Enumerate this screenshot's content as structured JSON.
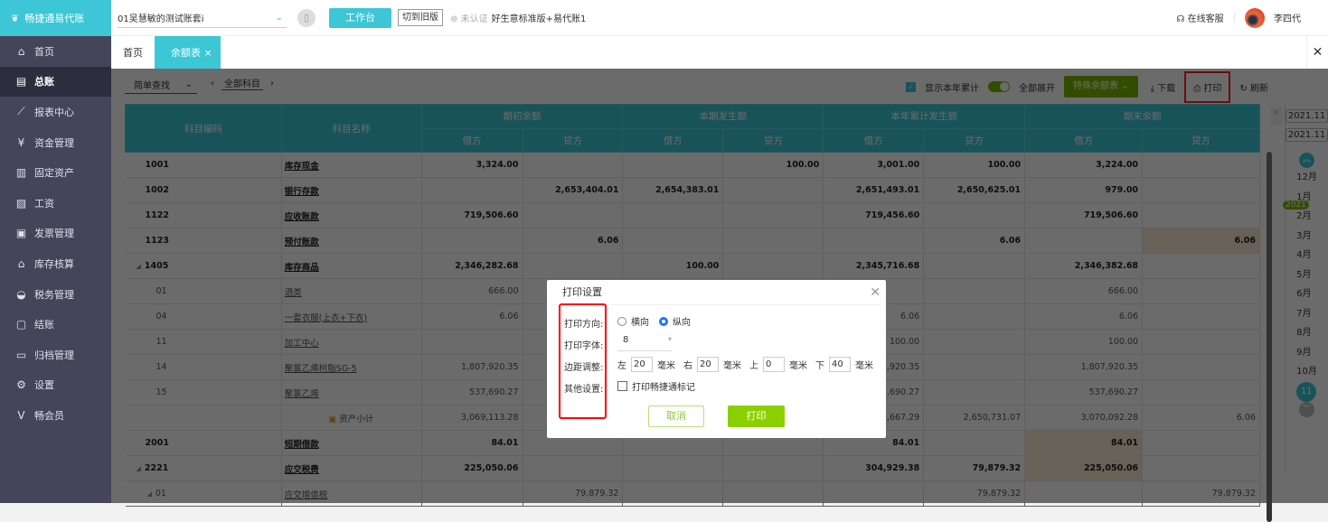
{
  "app": {
    "name": "畅捷通易代账",
    "account": "01吴慧敏的测试账套i",
    "workbench": "工作台",
    "switch_old": "切到旧版",
    "cert": "未认证",
    "version": "好生意标准版+易代账1",
    "service": "在线客服",
    "user": "李四代"
  },
  "sidebar": [
    {
      "icon": "home-icon",
      "glyph": "⌂",
      "label": "首页"
    },
    {
      "icon": "ledger-icon",
      "glyph": "▤",
      "label": "总账",
      "active": true
    },
    {
      "icon": "chart-icon",
      "glyph": "⟋",
      "label": "报表中心"
    },
    {
      "icon": "money-bag-icon",
      "glyph": "¥",
      "label": "资金管理"
    },
    {
      "icon": "building-icon",
      "glyph": "▥",
      "label": "固定资产"
    },
    {
      "icon": "salary-icon",
      "glyph": "▨",
      "label": "工资"
    },
    {
      "icon": "invoice-icon",
      "glyph": "▣",
      "label": "发票管理"
    },
    {
      "icon": "warehouse-icon",
      "glyph": "⌂",
      "label": "库存核算"
    },
    {
      "icon": "tax-icon",
      "glyph": "◒",
      "label": "税务管理"
    },
    {
      "icon": "close-account-icon",
      "glyph": "▢",
      "label": "结账"
    },
    {
      "icon": "archive-icon",
      "glyph": "▭",
      "label": "归档管理"
    },
    {
      "icon": "gear-icon",
      "glyph": "⚙",
      "label": "设置"
    },
    {
      "icon": "vip-icon",
      "glyph": "V",
      "label": "畅会员"
    }
  ],
  "tabs": [
    {
      "label": "首页"
    },
    {
      "label": "余额表 ×",
      "active": true
    }
  ],
  "toolbar": {
    "search": "简单查找",
    "subject": "全部科目",
    "show_year": "显示本年累计",
    "expand_all": "全部展开",
    "special": "特殊余额表",
    "download": "下载",
    "print": "打印",
    "refresh": "刷新"
  },
  "table": {
    "headers": {
      "code": "科目编码",
      "name": "科目名称",
      "groups": [
        "期初余额",
        "本期发生额",
        "本年累计发生额",
        "期末余额"
      ],
      "debit": "借方",
      "credit": "贷方"
    },
    "rows": [
      {
        "code": "1001",
        "name": "库存现金",
        "bold": true,
        "v": [
          "3,324.00",
          "",
          "",
          "100.00",
          "3,001.00",
          "100.00",
          "3,224.00",
          ""
        ]
      },
      {
        "code": "1002",
        "name": "银行存款",
        "bold": true,
        "v": [
          "",
          "2,653,404.01",
          "2,654,383.01",
          "",
          "2,651,493.01",
          "2,650,625.01",
          "979.00",
          ""
        ]
      },
      {
        "code": "1122",
        "name": "应收账款",
        "bold": true,
        "v": [
          "719,506.60",
          "",
          "",
          "",
          "719,456.60",
          "",
          "719,506.60",
          ""
        ]
      },
      {
        "code": "1123",
        "name": "预付账款",
        "bold": true,
        "v": [
          "",
          "6.06",
          "",
          "",
          "",
          "6.06",
          "",
          "6.06"
        ],
        "hl": [
          7
        ]
      },
      {
        "code": "1405",
        "name": "库存商品",
        "bold": true,
        "tree": true,
        "v": [
          "2,346,282.68",
          "",
          "100.00",
          "",
          "2,345,716.68",
          "",
          "2,346,382.68",
          ""
        ]
      },
      {
        "code": "01",
        "name": "酒类",
        "sub": true,
        "v": [
          "666.00",
          "",
          "",
          "",
          "",
          "",
          "666.00",
          ""
        ]
      },
      {
        "code": "04",
        "name": "一套衣服(上衣+下衣)",
        "sub": true,
        "v": [
          "6.06",
          "",
          "",
          "",
          "6.06",
          "",
          "6.06",
          ""
        ]
      },
      {
        "code": "11",
        "name": "加工中心",
        "sub": true,
        "v": [
          "",
          "",
          "",
          "",
          "100.00",
          "",
          "100.00",
          ""
        ]
      },
      {
        "code": "14",
        "name": "聚氯乙烯树脂SG-5",
        "sub": true,
        "v": [
          "1,807,920.35",
          "",
          "",
          "",
          "1,807,920.35",
          "",
          "1,807,920.35",
          ""
        ]
      },
      {
        "code": "15",
        "name": "聚氯乙烯",
        "sub": true,
        "v": [
          "537,690.27",
          "",
          "",
          "",
          "537,690.27",
          "",
          "537,690.27",
          ""
        ]
      },
      {
        "code": "",
        "name": "资产小计",
        "subtotal": true,
        "v": [
          "3,069,113.28",
          "",
          "",
          "",
          "9,667.29",
          "2,650,731.07",
          "3,070,092.28",
          "6.06"
        ]
      },
      {
        "code": "2001",
        "name": "短期借款",
        "bold": true,
        "v": [
          "84.01",
          "",
          "",
          "",
          "84.01",
          "",
          "84.01",
          ""
        ],
        "hl": [
          6
        ]
      },
      {
        "code": "2221",
        "name": "应交税费",
        "bold": true,
        "tree": true,
        "v": [
          "225,050.06",
          "",
          "",
          "",
          "304,929.38",
          "79,879.32",
          "225,050.06",
          ""
        ],
        "hl": [
          6
        ]
      },
      {
        "code": "01",
        "name": "应交增值税",
        "sub": true,
        "tree": true,
        "v": [
          "",
          "79,879.32",
          "",
          "",
          "",
          "79,879.32",
          "",
          "79,879.32"
        ]
      }
    ]
  },
  "period": {
    "from": "2021.11",
    "to": "2021.11",
    "year": "2021",
    "months": [
      "12月",
      "1月",
      "2月",
      "3月",
      "4月",
      "5月",
      "6月",
      "7月",
      "8月",
      "9月",
      "10月",
      "11月"
    ],
    "current": "11月"
  },
  "dialog": {
    "title": "打印设置",
    "orientation_label": "打印方向:",
    "landscape": "横向",
    "portrait": "纵向",
    "orientation": "portrait",
    "font_label": "打印字体:",
    "font_size": "8",
    "margin_label": "边距调整:",
    "left": "左",
    "left_val": "20",
    "right": "右",
    "right_val": "20",
    "top": "上",
    "top_val": "0",
    "bottom": "下",
    "bottom_val": "40",
    "unit": "毫米",
    "other_label": "其他设置:",
    "logo_option": "打印畅捷通标记",
    "cancel": "取消",
    "print": "打印"
  },
  "colors": {
    "accent": "#3cc6d6",
    "green": "#7ab800",
    "sidebar": "#454559"
  }
}
